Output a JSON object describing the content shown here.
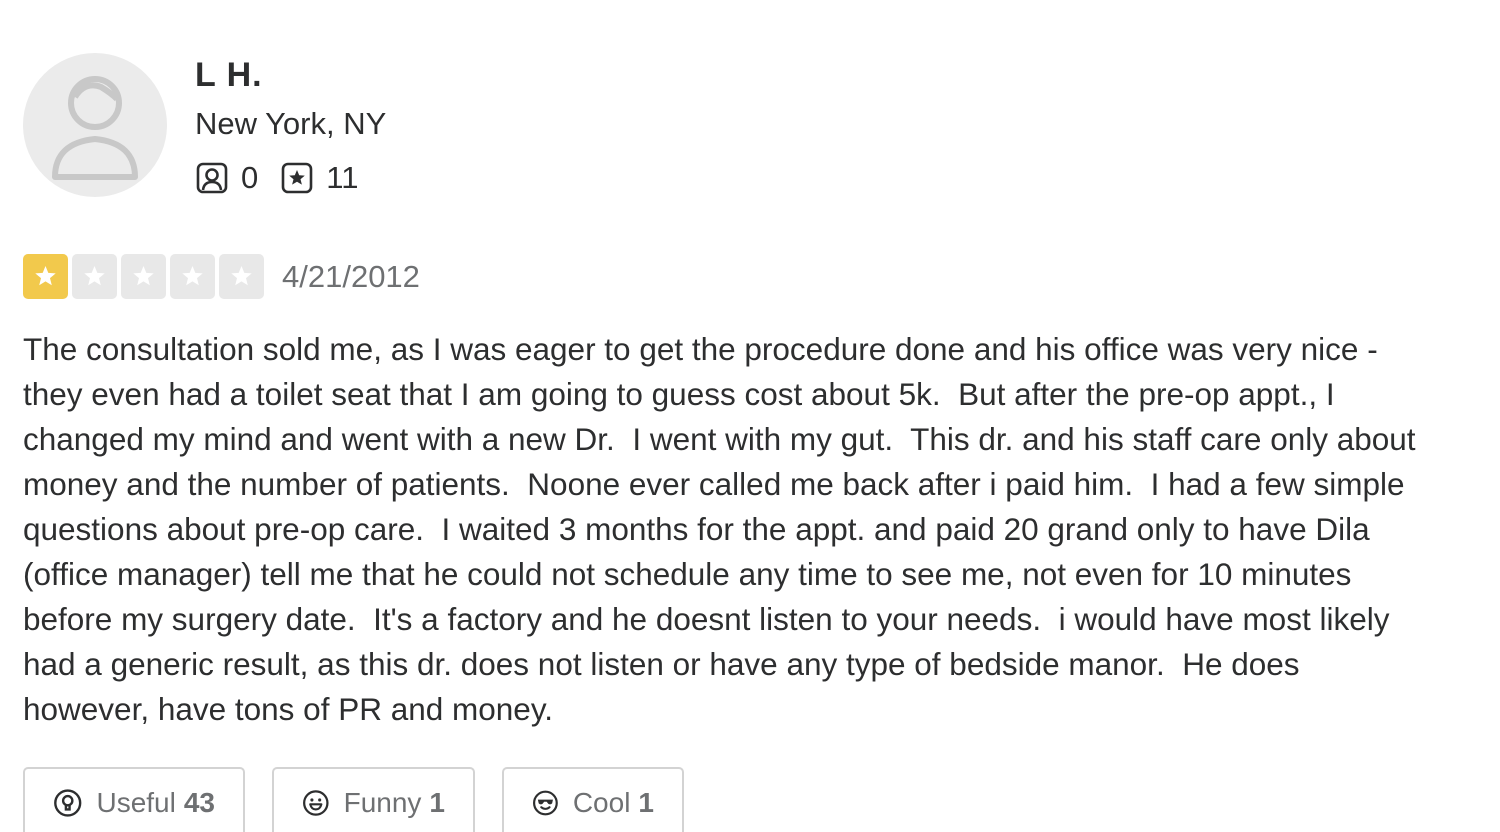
{
  "user": {
    "name": "L H.",
    "location": "New York, NY",
    "friends_count": "0",
    "reviews_count": "11",
    "avatar_icon": "default-user-avatar-icon"
  },
  "review": {
    "rating": 1,
    "max_rating": 5,
    "star_color": "#f2c94c",
    "date": "4/21/2012",
    "text": "The consultation sold me, as I was eager to get the procedure done and his office was very nice -\nthey even had a toilet seat that I am going to guess cost about 5k.  But after the pre-op appt., I\nchanged my mind and went with a new Dr.  I went with my gut.  This dr. and his staff care only about\nmoney and the number of patients.  Noone ever called me back after i paid him.  I had a few simple\nquestions about pre-op care.  I waited 3 months for the appt. and paid 20 grand only to have Dila\n(office manager) tell me that he could not schedule any time to see me, not even for 10 minutes\nbefore my surgery date.  It's a factory and he doesnt listen to your needs.  i would have most likely\nhad a generic result, as this dr. does not listen or have any type of bedside manor.  He does\nhowever, have tons of PR and money."
  },
  "reactions": {
    "useful": {
      "label": "Useful",
      "count": "43",
      "icon": "lightbulb-icon"
    },
    "funny": {
      "label": "Funny",
      "count": "1",
      "icon": "smile-face-icon"
    },
    "cool": {
      "label": "Cool",
      "count": "1",
      "icon": "sunglasses-face-icon"
    }
  }
}
